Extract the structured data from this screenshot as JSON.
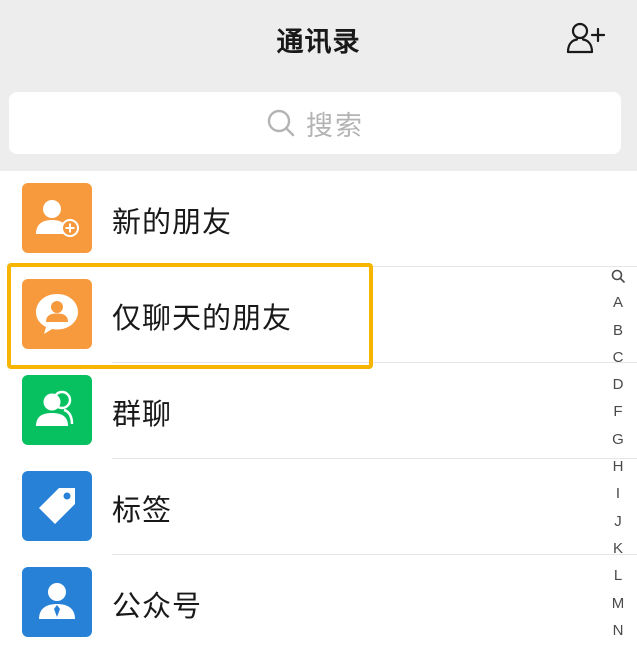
{
  "header": {
    "title": "通讯录",
    "add_contact_icon": "add-contact-icon"
  },
  "search": {
    "placeholder": "搜索",
    "icon": "search-icon"
  },
  "list": {
    "items": [
      {
        "label": "新的朋友",
        "icon": "new-friend-icon",
        "icon_color": "#f79a3e"
      },
      {
        "label": "仅聊天的朋友",
        "icon": "chat-only-friend-icon",
        "icon_color": "#f79a3e",
        "highlighted": true
      },
      {
        "label": "群聊",
        "icon": "group-chat-icon",
        "icon_color": "#07c160"
      },
      {
        "label": "标签",
        "icon": "tag-icon",
        "icon_color": "#2782d7"
      },
      {
        "label": "公众号",
        "icon": "official-account-icon",
        "icon_color": "#2782d7"
      }
    ]
  },
  "index": {
    "search_icon": "index-search-icon",
    "letters": [
      "A",
      "B",
      "C",
      "D",
      "F",
      "G",
      "H",
      "I",
      "J",
      "K",
      "L",
      "M",
      "N"
    ]
  },
  "colors": {
    "highlight": "#f7b500",
    "background": "#ededed"
  }
}
